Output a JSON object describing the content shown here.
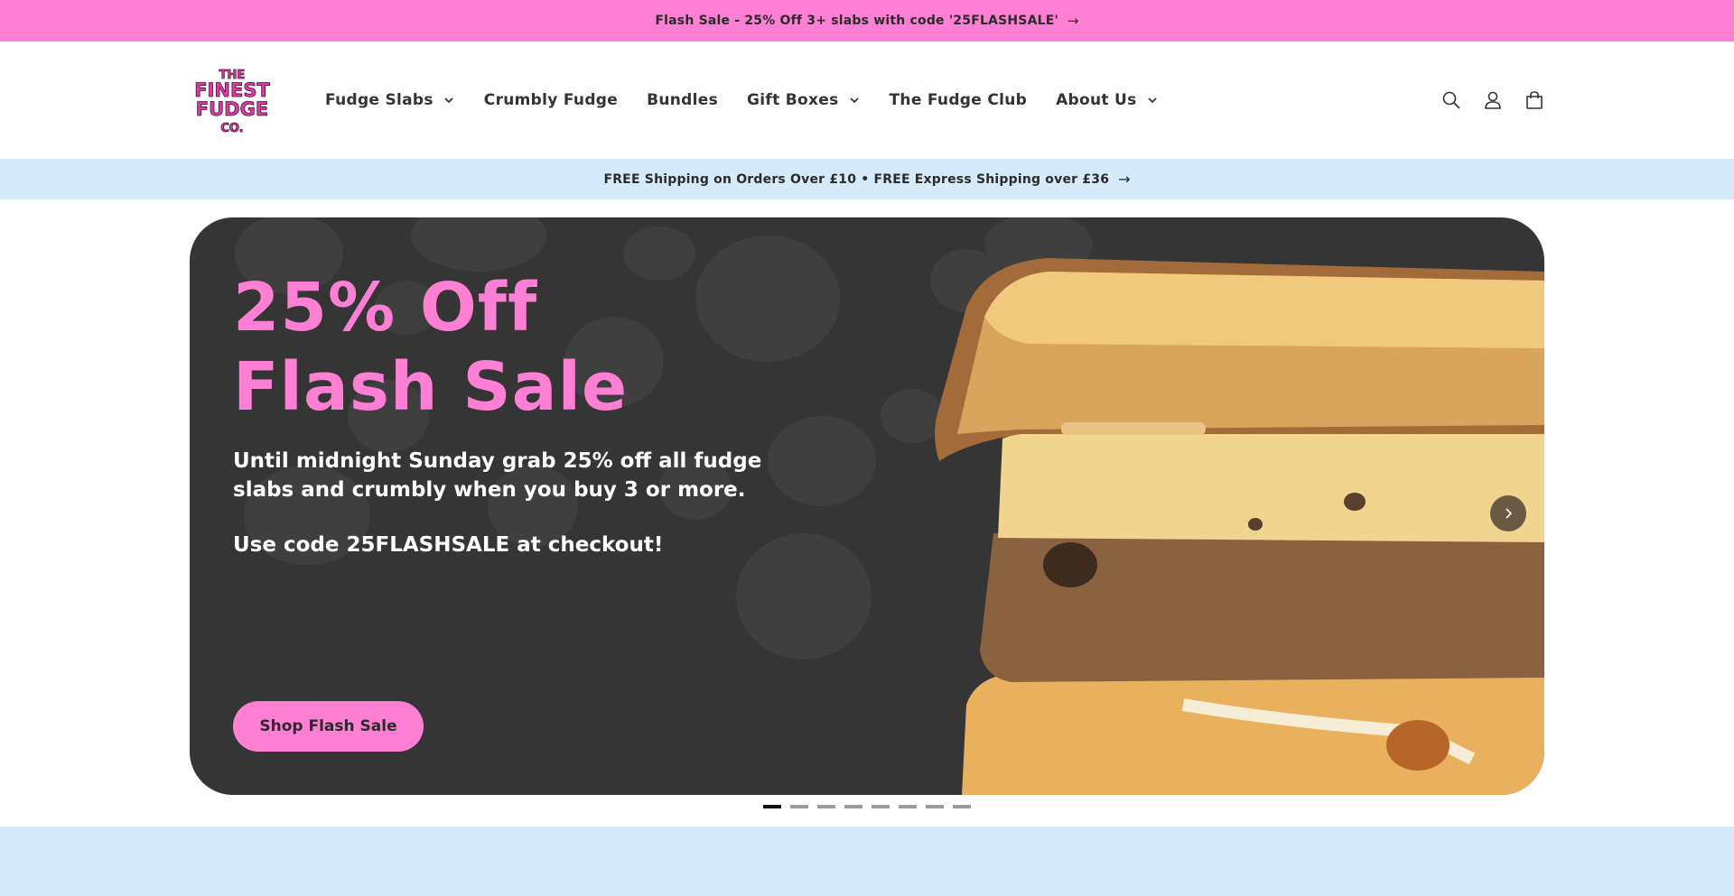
{
  "announcement": {
    "text": "Flash Sale - 25% Off 3+ slabs with code '25FLASHSALE'",
    "arrow": "→"
  },
  "brand": {
    "logo_lines": [
      "THE",
      "FINEST",
      "FUDGE",
      "CO."
    ],
    "accent": "#ff7fd4",
    "logo_color": "#e23aa7"
  },
  "nav": {
    "items": [
      {
        "label": "Fudge Slabs",
        "has_dropdown": true
      },
      {
        "label": "Crumbly Fudge",
        "has_dropdown": false
      },
      {
        "label": "Bundles",
        "has_dropdown": false
      },
      {
        "label": "Gift Boxes",
        "has_dropdown": true
      },
      {
        "label": "The Fudge Club",
        "has_dropdown": false
      },
      {
        "label": "About Us",
        "has_dropdown": true
      }
    ]
  },
  "header_icons": [
    "search-icon",
    "account-icon",
    "cart-icon"
  ],
  "shipping": {
    "text": "FREE Shipping on Orders Over £10 • FREE Express Shipping over £36",
    "arrow": "→"
  },
  "hero": {
    "title_line1": "25% Off",
    "title_line2": "Flash Sale",
    "description": "Until midnight Sunday grab 25% off all fudge slabs and crumbly when you buy 3 or more.",
    "code_text": "Use code 25FLASHSALE at checkout!",
    "button_label": "Shop Flash Sale",
    "background": "#353535"
  },
  "slider": {
    "total_slides": 8,
    "active_slide": 1
  }
}
